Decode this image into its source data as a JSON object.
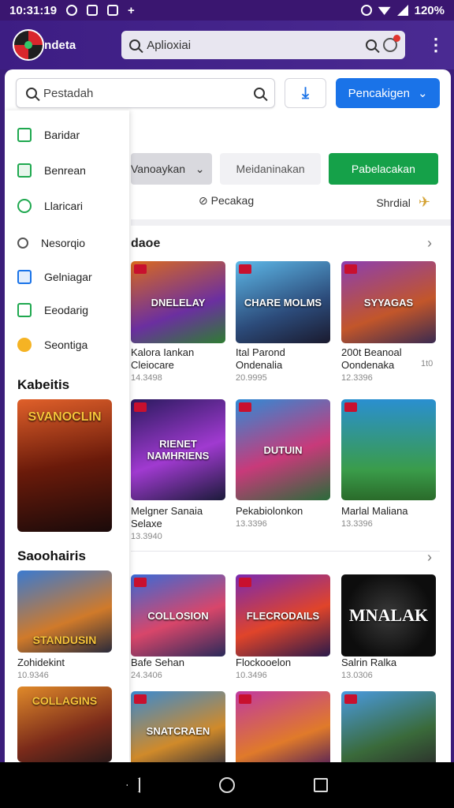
{
  "status_bar": {
    "time": "10:31:19",
    "battery": "120%"
  },
  "app_bar": {
    "brand": "Indeta",
    "search_placeholder": "Aplioxiai"
  },
  "panel": {
    "search_placeholder": "Pestadah",
    "primary_button": "Pencakigen",
    "filter_select": "Vanoaykan",
    "filter_input": "Meidaninakan",
    "green_button": "Pabelacakan",
    "tag_left": "Pecakag",
    "tag_right": "Shrdial"
  },
  "sidebar": {
    "items": [
      "Baridar",
      "Benrean",
      "Llaricari",
      "Nesorqio",
      "Gelniagar",
      "Eeodarig",
      "Seontiga"
    ],
    "section1": "Kabeitis",
    "section2": "Saoohairis",
    "card1": "SVANOCLIN",
    "card2": "STANDUSIN",
    "card3": "COLLAGINS",
    "cap3_title": "Zohidekint",
    "cap3_sub": "10.9346"
  },
  "content": {
    "section1_title": "daoe",
    "row1": [
      {
        "title": "DNELELAY",
        "line1": "Kalora Iankan",
        "line2": "Cleiocare",
        "sub": "14.3498"
      },
      {
        "title": "CHARE MOLMS",
        "line1": "Ital Parond",
        "line2": "Ondenalia",
        "sub": "20.9995"
      },
      {
        "title": "SYYAGAS",
        "line1": "200t Beanoal",
        "line2": "Oondenaka",
        "sub": "12.3396"
      }
    ],
    "row1_extra": "1t0",
    "row2": [
      {
        "title": "RIENET NAMHRIENS",
        "line1": "Melgner Sanaia",
        "line2": "Selaxe",
        "sub": "13.3940"
      },
      {
        "title": "DUTUIN",
        "line1": "Pekabiolonkon",
        "line2": "",
        "sub": "13.3396"
      },
      {
        "title": "",
        "line1": "Marlal Maliana",
        "line2": "",
        "sub": "13.3396"
      }
    ],
    "row3": [
      {
        "title": "COLLOSION",
        "line1": "Bafe Sehan",
        "line2": "",
        "sub": "24.3406"
      },
      {
        "title": "FLECRODAILS",
        "line1": "Flockooelon",
        "line2": "",
        "sub": "10.3496"
      },
      {
        "title": "MNALAK",
        "line1": "Salrin Ralka",
        "line2": "",
        "sub": "13.0306"
      }
    ],
    "row4": [
      "SNATCRAEN",
      "",
      ""
    ]
  }
}
